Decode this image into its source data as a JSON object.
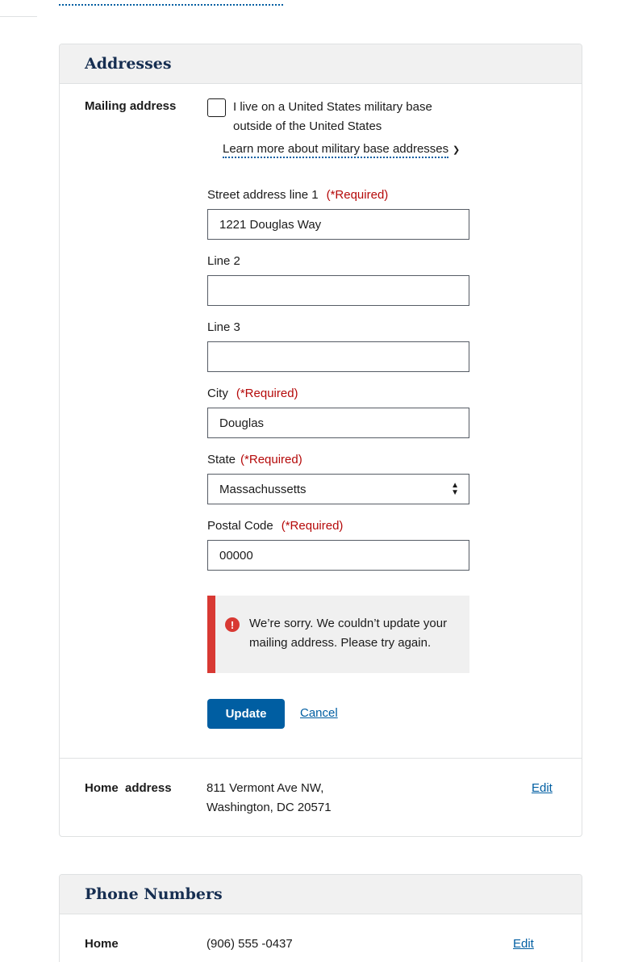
{
  "addresses": {
    "title": "Addresses",
    "mailing": {
      "label": "Mailing address",
      "military_checkbox_label": "I live on a United States military base outside of the United States",
      "learn_more_link": "Learn more about military base addresses",
      "fields": {
        "street1": {
          "label": "Street address line 1",
          "required": "(*Required)",
          "value": "1221 Douglas Way"
        },
        "line2": {
          "label": "Line 2",
          "value": ""
        },
        "line3": {
          "label": "Line 3",
          "value": ""
        },
        "city": {
          "label": "City",
          "required": "(*Required)",
          "value": "Douglas"
        },
        "state": {
          "label": "State",
          "required": "(*Required)",
          "value": "Massachussetts"
        },
        "postal": {
          "label": "Postal Code",
          "required": "(*Required)",
          "value": "00000"
        }
      },
      "error_message": "We’re sorry. We couldn’t update your mailing address. Please try again.",
      "update_label": "Update",
      "cancel_label": "Cancel"
    },
    "home": {
      "label": "Home  address",
      "line1": "811 Vermont Ave NW,",
      "line2": "Washington, DC 20571",
      "edit_label": "Edit"
    }
  },
  "phones": {
    "title": "Phone Numbers",
    "home": {
      "label": "Home",
      "value": "(906) 555 -0437",
      "edit_label": "Edit"
    }
  },
  "colors": {
    "primary": "#005ea2",
    "error": "#d83933",
    "required": "#b50909",
    "heading": "#162e51"
  },
  "icons": {
    "chevron": "chevron-down-icon",
    "select": "select-arrows-icon",
    "error": "error-icon"
  }
}
